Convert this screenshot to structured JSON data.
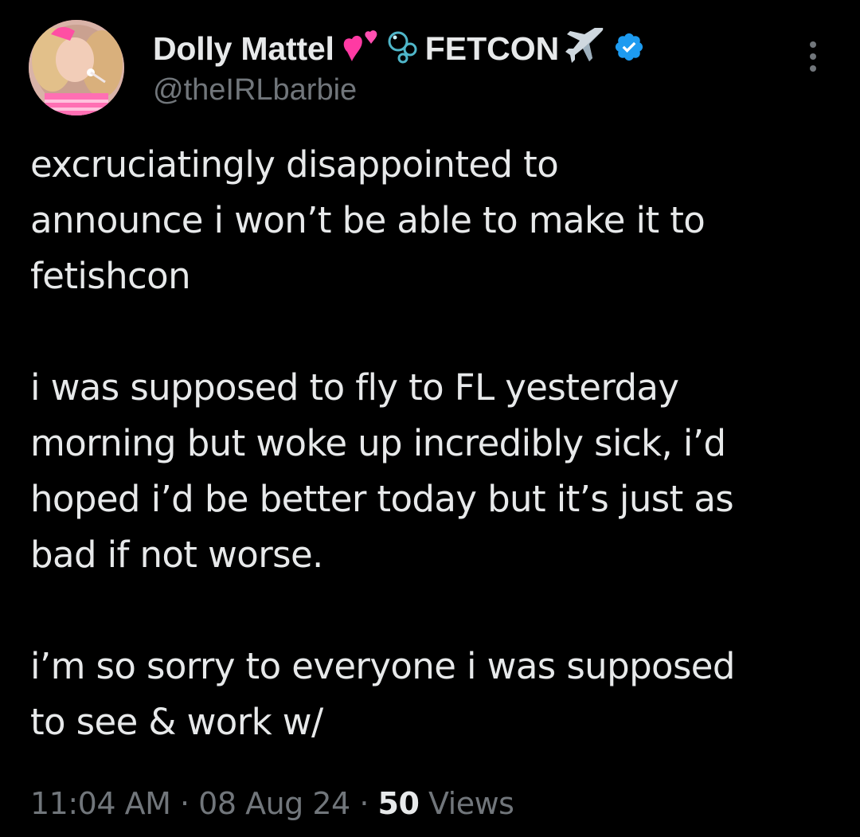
{
  "author": {
    "display_name": "Dolly Mattel",
    "emojis": [
      "two-hearts-emoji",
      "bubbles-emoji"
    ],
    "name_suffix": "FETCON",
    "suffix_emoji": "airplane-emoji",
    "verified": true,
    "verified_color": "#1d9bf0",
    "handle": "@theIRLbarbie"
  },
  "tweet": {
    "paragraphs": [
      [
        "excruciatingly disappointed to",
        "announce i won’t be able to make it to",
        "fetishcon"
      ],
      [
        "i was supposed to fly to FL yesterday",
        "morning but woke up incredibly sick, i’d",
        "hoped i’d be better today but it’s just as",
        "bad if not worse."
      ],
      [
        "i’m so sorry to everyone i was supposed",
        "to see & work w/"
      ]
    ]
  },
  "meta": {
    "time": "11:04 AM",
    "separator": "·",
    "date": "08 Aug 24",
    "views_count": "50",
    "views_label": "Views"
  },
  "icons": {
    "more": "more-vertical-icon"
  },
  "colors": {
    "background": "#000000",
    "primary_text": "#e7e9ea",
    "secondary_text": "#71767b"
  }
}
